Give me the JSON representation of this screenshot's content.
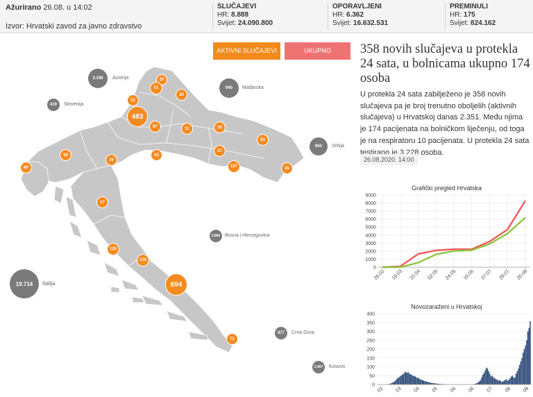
{
  "header": {
    "updated_label": "Ažurirano",
    "updated_value": "26.08. u 14:02",
    "source": "Izvor: Hrvatski zavod za javno zdravstvo"
  },
  "stats": [
    {
      "title": "SLUČAJEVI",
      "hr_label": "HR:",
      "hr_value": "8.888",
      "world_label": "Svijet:",
      "world_value": "24.090.800"
    },
    {
      "title": "OPORAVLJENI",
      "hr_label": "HR:",
      "hr_value": "6.362",
      "world_label": "Svijet:",
      "world_value": "16.632.531"
    },
    {
      "title": "PREMINULI",
      "hr_label": "HR:",
      "hr_value": "175",
      "world_label": "Svijet:",
      "world_value": "824.162"
    }
  ],
  "buttons": {
    "active": "AKTIVNI SLUČAJEVI",
    "total": "UKUPNO"
  },
  "colors": {
    "accent": "#f58a1f",
    "total": "#f07373",
    "neighbor": "#7a7a7a",
    "recovered_line": "#8cc63f",
    "cases_line": "#f05a5a",
    "bars": "#1f3f6f"
  },
  "map": {
    "counties": [
      "25",
      "51",
      "26",
      "21",
      "483",
      "97",
      "11",
      "16",
      "83",
      "56",
      "39",
      "43",
      "27",
      "127",
      "38",
      "80",
      "17",
      "126",
      "136",
      "694",
      "71"
    ],
    "neighbors": [
      {
        "value": "3.198",
        "name": "Austrija"
      },
      {
        "value": "940",
        "name": "Mađarska"
      },
      {
        "value": "419",
        "name": "Slovenija"
      },
      {
        "value": "963",
        "name": "Srbija"
      },
      {
        "value": "3.880",
        "name": "Bosna i Hercegovina"
      },
      {
        "value": "19.714",
        "name": "Italija"
      },
      {
        "value": "877",
        "name": "Crna Gora"
      },
      {
        "value": "2.407",
        "name": "Kosovo"
      }
    ]
  },
  "article": {
    "headline": "358 novih slučajeva u protekla 24 sata, u bolnicama ukupno 174 osoba",
    "body": "U protekla 24 sata zabilježeno je 358 novih slučajeva pa je broj trenutno oboljelih (aktivnih slučajeva) u Hrvatskoj danas 2.351. Među njima je 174 pacijenata na bolničkom liječenju, od toga je na respiratoru 10 pacijenata. U protekla 24 sata testirano je 3.228 osoba.",
    "date": "26.08.2020. 14:00"
  },
  "chart_data": [
    {
      "type": "line",
      "title": "Grafički pregled Hrvatska",
      "x": [
        "26.02",
        "19.03",
        "10.04",
        "02.05",
        "24.05",
        "15.06",
        "07.07",
        "29.07",
        "20.08"
      ],
      "ylim": [
        0,
        9000
      ],
      "yticks": [
        0,
        1000,
        2000,
        3000,
        4000,
        5000,
        6000,
        7000,
        8000,
        9000
      ],
      "series": [
        {
          "values": [
            0,
            105,
            1650,
            2100,
            2245,
            2250,
            3200,
            4700,
            8300
          ],
          "color": "#f05a5a"
        },
        {
          "values": [
            0,
            5,
            560,
            1600,
            2020,
            2120,
            2900,
            4200,
            6200
          ],
          "color": "#8cc63f"
        }
      ]
    },
    {
      "type": "bar",
      "title": "Novozaraženi u Hrvatskoj",
      "ylim": [
        0,
        400
      ],
      "yticks": [
        0,
        50,
        100,
        150,
        200,
        250,
        300,
        350,
        400
      ],
      "x": [
        "02",
        "03",
        "04",
        "05",
        "06",
        "06",
        "07",
        "08",
        "08"
      ],
      "values": [
        0,
        0,
        0,
        0,
        0,
        0,
        0,
        0,
        1,
        2,
        3,
        5,
        8,
        12,
        15,
        20,
        28,
        35,
        40,
        45,
        50,
        55,
        60,
        68,
        72,
        65,
        70,
        62,
        58,
        55,
        48,
        50,
        45,
        40,
        38,
        35,
        30,
        28,
        25,
        22,
        20,
        18,
        15,
        14,
        12,
        10,
        9,
        8,
        7,
        6,
        5,
        5,
        4,
        3,
        3,
        2,
        2,
        2,
        1,
        1,
        1,
        0,
        0,
        1,
        0,
        0,
        1,
        2,
        0,
        1,
        0,
        0,
        1,
        0,
        0,
        1,
        0,
        0,
        0,
        1,
        1,
        2,
        3,
        5,
        8,
        12,
        18,
        25,
        40,
        55,
        65,
        80,
        95,
        90,
        75,
        60,
        45,
        50,
        40,
        35,
        30,
        28,
        22,
        25,
        20,
        15,
        18,
        22,
        25,
        30,
        20,
        28,
        35,
        45,
        50,
        40,
        38,
        60,
        75,
        90,
        110,
        130,
        150,
        180,
        200,
        220,
        250,
        300,
        320,
        358
      ]
    }
  ]
}
